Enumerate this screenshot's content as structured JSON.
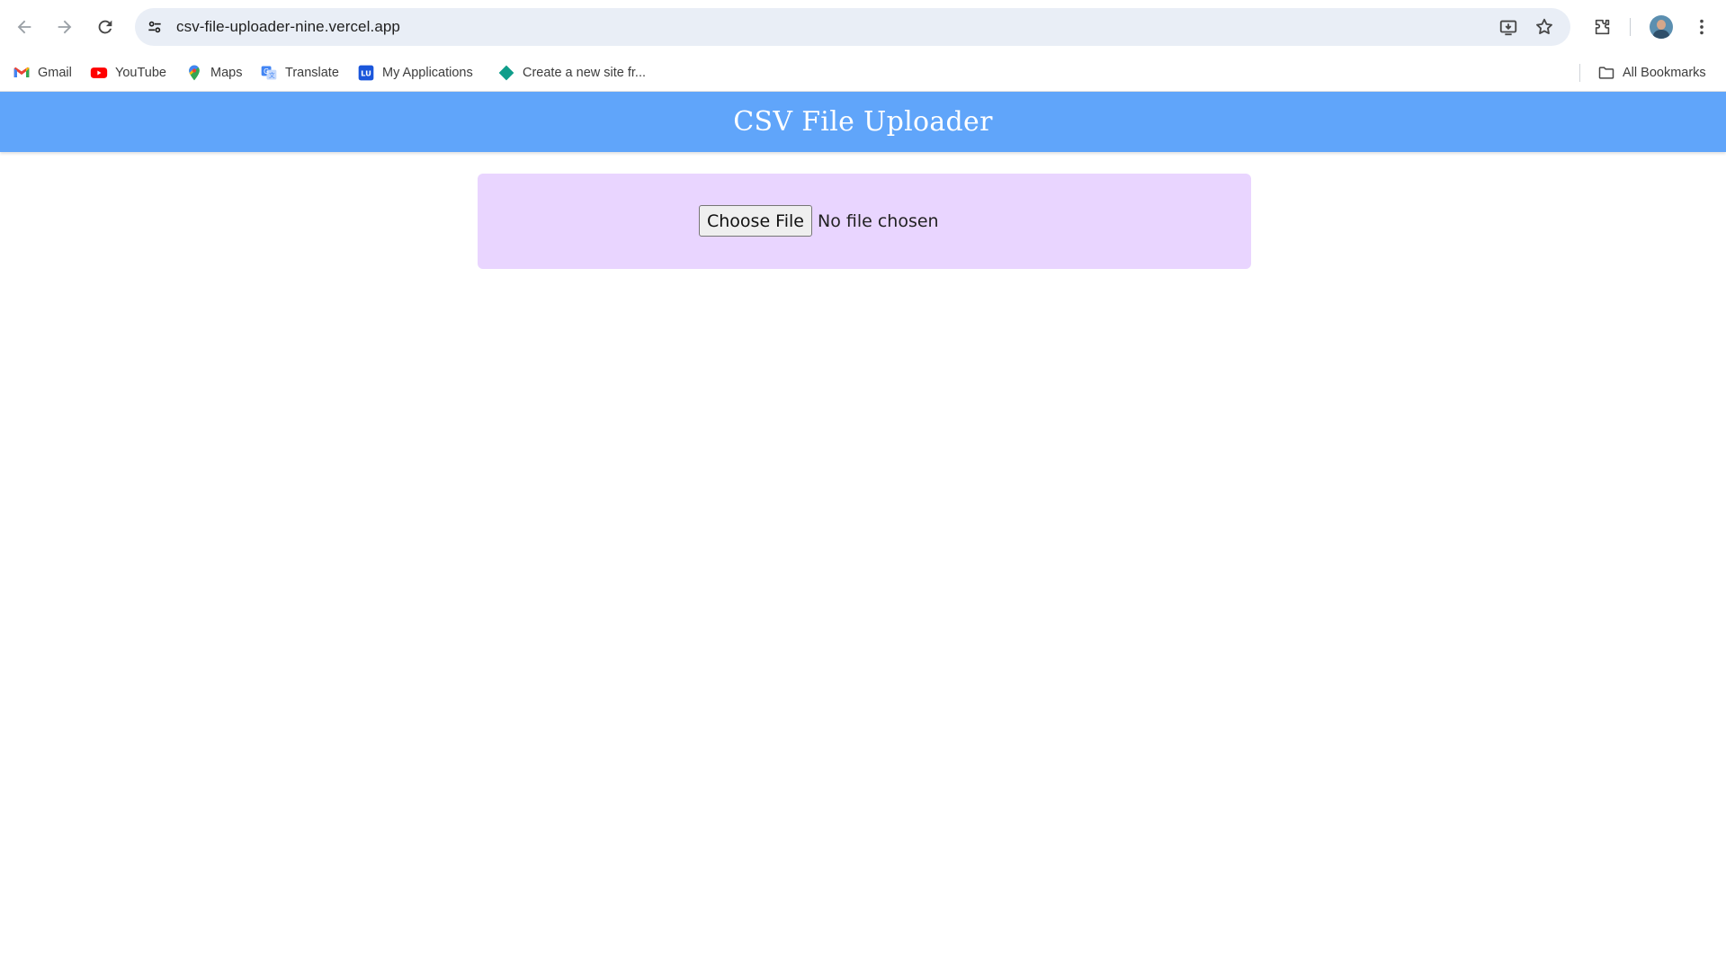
{
  "browser": {
    "url": "csv-file-uploader-nine.vercel.app",
    "icons": {
      "back": "arrow-left-icon",
      "forward": "arrow-right-icon",
      "reload": "reload-icon",
      "site_info": "tune-icon",
      "install": "install-app-icon",
      "bookmark": "star-icon",
      "extensions": "puzzle-icon",
      "menu": "kebab-menu-icon"
    }
  },
  "bookmarks": {
    "items": [
      {
        "label": "Gmail",
        "icon": "gmail-icon"
      },
      {
        "label": "YouTube",
        "icon": "youtube-icon"
      },
      {
        "label": "Maps",
        "icon": "maps-icon"
      },
      {
        "label": "Translate",
        "icon": "translate-icon"
      },
      {
        "label": "My Applications",
        "icon": "lu-icon"
      },
      {
        "label": "Create a new site fr...",
        "icon": "diamond-icon"
      }
    ],
    "all_bookmarks": "All Bookmarks"
  },
  "app": {
    "title": "CSV File Uploader",
    "header_color": "#60a5fa",
    "card_color": "#e9d5ff",
    "file_input": {
      "button_label": "Choose File",
      "status": "No file chosen"
    }
  }
}
